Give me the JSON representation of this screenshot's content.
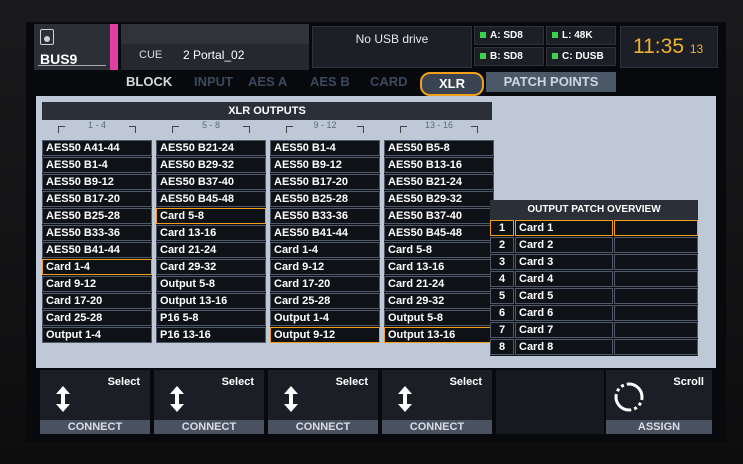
{
  "header": {
    "channel_name": "BUS9",
    "cue_label": "CUE",
    "cue_name": "2 Portal_02",
    "usb_status": "No USB drive",
    "card_status": [
      {
        "label": "A: SD8"
      },
      {
        "label": "L: 48K"
      },
      {
        "label": "B: SD8"
      },
      {
        "label": "C: DUSB"
      }
    ],
    "clock_main": "11:35",
    "clock_seconds": "13",
    "accent_color": "#f2a01c",
    "channel_color": "#e040a0",
    "status_dot_color": "#39d24a"
  },
  "tabs": {
    "block": "BLOCK",
    "input": "INPUT",
    "aes_a": "AES A",
    "aes_b": "AES B",
    "card": "CARD",
    "xlr": "XLR",
    "patch_points": "PATCH POINTS"
  },
  "section_title": "XLR OUTPUTS",
  "columns": [
    {
      "range": "1 - 4",
      "items": [
        "AES50 A41-44",
        "AES50 B1-4",
        "AES50 B9-12",
        "AES50 B17-20",
        "AES50 B25-28",
        "AES50 B33-36",
        "AES50 B41-44",
        "Card 1-4",
        "Card 9-12",
        "Card 17-20",
        "Card 25-28",
        "Output 1-4"
      ],
      "selected_index": 7
    },
    {
      "range": "5 - 8",
      "items": [
        "AES50 B21-24",
        "AES50 B29-32",
        "AES50 B37-40",
        "AES50 B45-48",
        "Card 5-8",
        "Card 13-16",
        "Card 21-24",
        "Card 29-32",
        "Output 5-8",
        "Output 13-16",
        "P16 5-8",
        "P16 13-16"
      ],
      "selected_index": 4
    },
    {
      "range": "9 - 12",
      "items": [
        "AES50 B1-4",
        "AES50 B9-12",
        "AES50 B17-20",
        "AES50 B25-28",
        "AES50 B33-36",
        "AES50 B41-44",
        "Card 1-4",
        "Card 9-12",
        "Card 17-20",
        "Card 25-28",
        "Output 1-4",
        "Output 9-12"
      ],
      "selected_index": 11
    },
    {
      "range": "13 - 16",
      "items": [
        "AES50 B5-8",
        "AES50 B13-16",
        "AES50 B21-24",
        "AES50 B29-32",
        "AES50 B37-40",
        "AES50 B45-48",
        "Card 5-8",
        "Card 13-16",
        "Card 21-24",
        "Card 29-32",
        "Output 5-8",
        "Output 13-16"
      ],
      "selected_index": 11
    }
  ],
  "overview": {
    "title": "OUTPUT PATCH OVERVIEW",
    "rows": [
      {
        "num": "1",
        "name": "Card 1"
      },
      {
        "num": "2",
        "name": "Card 2"
      },
      {
        "num": "3",
        "name": "Card 3"
      },
      {
        "num": "4",
        "name": "Card 4"
      },
      {
        "num": "5",
        "name": "Card 5"
      },
      {
        "num": "6",
        "name": "Card 6"
      },
      {
        "num": "7",
        "name": "Card 7"
      },
      {
        "num": "8",
        "name": "Card 8"
      }
    ],
    "selected_index": 0
  },
  "controls": {
    "select_label": "Select",
    "connect_label": "CONNECT",
    "scroll_label": "Scroll",
    "assign_label": "ASSIGN"
  }
}
